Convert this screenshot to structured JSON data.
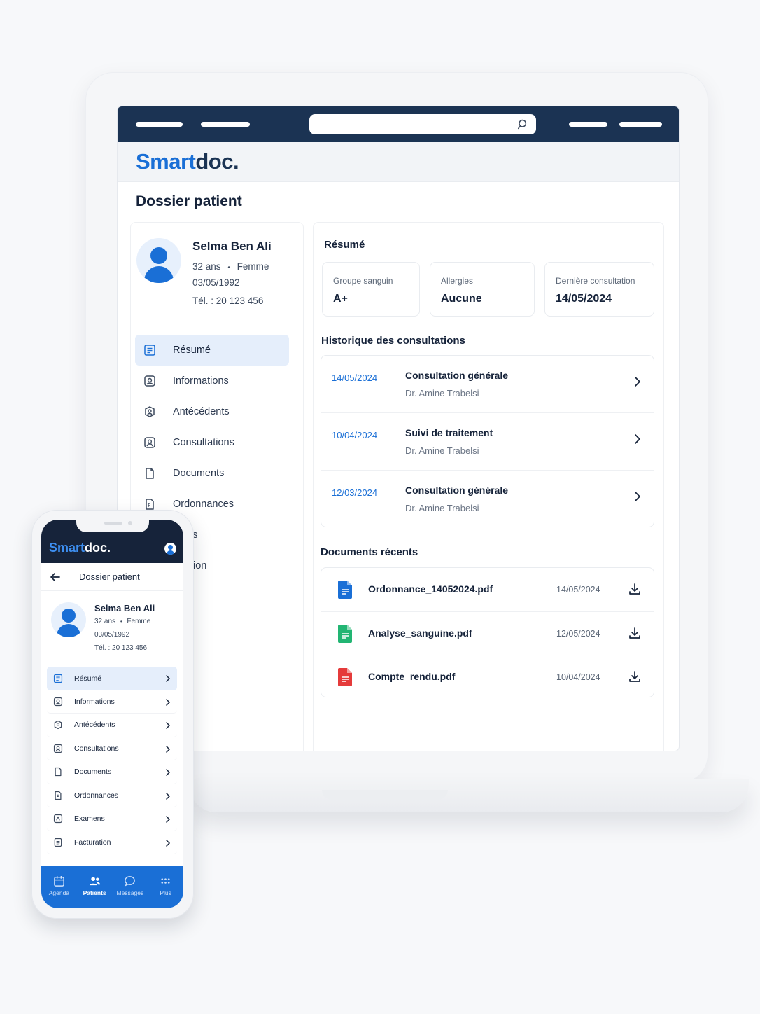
{
  "laptop": {
    "brand": {
      "part1": "Smart",
      "part2": "doc."
    },
    "page_title": "Dossier patient",
    "patient": {
      "name": "Selma Ben Ali",
      "age": "32 ans",
      "sex": "Femme",
      "birthdate": "03/05/1992",
      "phone": "Tél. : 20 123 456"
    },
    "nav": [
      {
        "label": "Résumé",
        "icon": "summary-icon",
        "active": true
      },
      {
        "label": "Informations",
        "icon": "id-card-icon"
      },
      {
        "label": "Antécédents",
        "icon": "history-icon"
      },
      {
        "label": "Consultations",
        "icon": "doctor-icon"
      },
      {
        "label": "Documents",
        "icon": "document-icon"
      },
      {
        "label": "Ordonnances",
        "icon": "prescription-icon"
      },
      {
        "label": "mens",
        "icon": "exam-icon"
      },
      {
        "label": "turation",
        "icon": "billing-icon"
      }
    ],
    "summary": {
      "title": "Résumé",
      "cards": [
        {
          "label": "Groupe sanguin",
          "value": "A+"
        },
        {
          "label": "Allergies",
          "value": "Aucune"
        },
        {
          "label": "Dernière consultation",
          "value": "14/05/2024"
        }
      ]
    },
    "history": {
      "title": "Historique des consultations",
      "rows": [
        {
          "date": "14/05/2024",
          "title": "Consultation générale",
          "doctor": "Dr. Amine Trabelsi"
        },
        {
          "date": "10/04/2024",
          "title": "Suivi de traitement",
          "doctor": "Dr. Amine Trabelsi"
        },
        {
          "date": "12/03/2024",
          "title": "Consultation générale",
          "doctor": "Dr. Amine Trabelsi"
        }
      ]
    },
    "documents": {
      "title": "Documents récents",
      "rows": [
        {
          "name": "Ordonnance_14052024.pdf",
          "date": "14/05/2024",
          "color": "#1a6fd6"
        },
        {
          "name": "Analyse_sanguine.pdf",
          "date": "12/05/2024",
          "color": "#22b573"
        },
        {
          "name": "Compte_rendu.pdf",
          "date": "10/04/2024",
          "color": "#e53b3b"
        }
      ]
    }
  },
  "phone": {
    "brand": {
      "part1": "Smart",
      "part2": "doc."
    },
    "title": "Dossier patient",
    "patient": {
      "name": "Selma Ben Ali",
      "age": "32 ans",
      "sex": "Femme",
      "birthdate": "03/05/1992",
      "phone": "Tél. : 20 123 456"
    },
    "nav": [
      {
        "label": "Résumé",
        "active": true
      },
      {
        "label": "Informations"
      },
      {
        "label": "Antécédents"
      },
      {
        "label": "Consultations"
      },
      {
        "label": "Documents"
      },
      {
        "label": "Ordonnances"
      },
      {
        "label": "Examens"
      },
      {
        "label": "Facturation"
      }
    ],
    "tabs": [
      {
        "label": "Agenda",
        "icon": "calendar-icon"
      },
      {
        "label": "Patients",
        "icon": "patients-icon",
        "active": true
      },
      {
        "label": "Messages",
        "icon": "chat-icon"
      },
      {
        "label": "Plus",
        "icon": "grid-icon"
      }
    ]
  },
  "colors": {
    "accent": "#1a6fd6",
    "navy": "#1b3353",
    "text": "#16233a"
  }
}
